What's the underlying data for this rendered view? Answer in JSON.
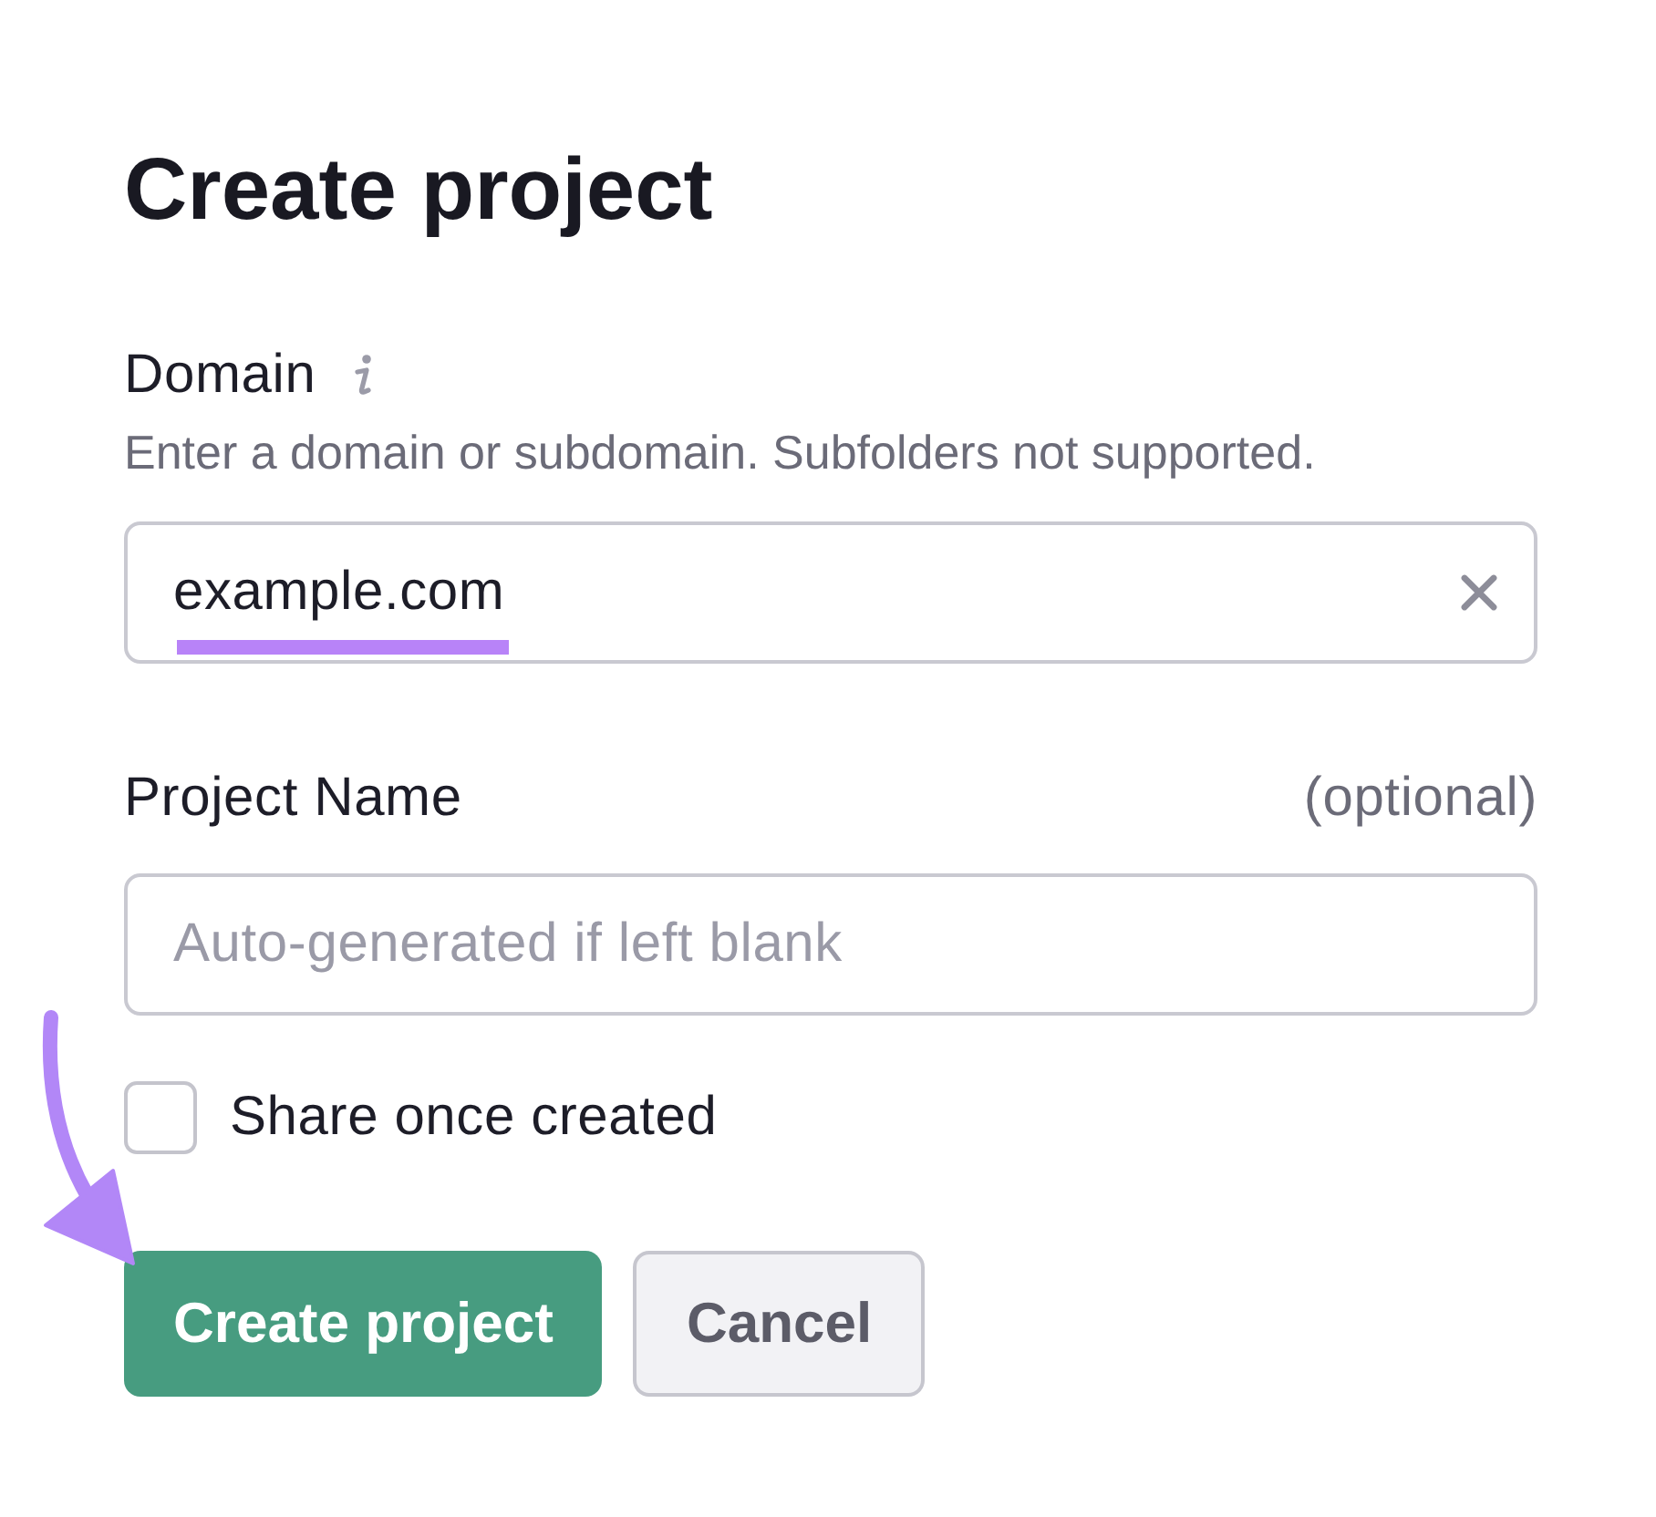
{
  "title": "Create project",
  "fields": [
    {
      "label": "Domain",
      "info": true,
      "hint": "Enter a domain or subdomain. Subfolders not supported.",
      "value": "example.com",
      "clearable": true,
      "highlighted": true
    },
    {
      "label": "Project Name",
      "note": "(optional)",
      "placeholder": "Auto-generated if left blank"
    }
  ],
  "checkbox": {
    "label": "Share once created",
    "checked": false
  },
  "buttons": [
    {
      "label": "Create project",
      "kind": "primary",
      "pointed": true
    },
    {
      "label": "Cancel",
      "kind": "secondary",
      "pointed": false
    }
  ]
}
